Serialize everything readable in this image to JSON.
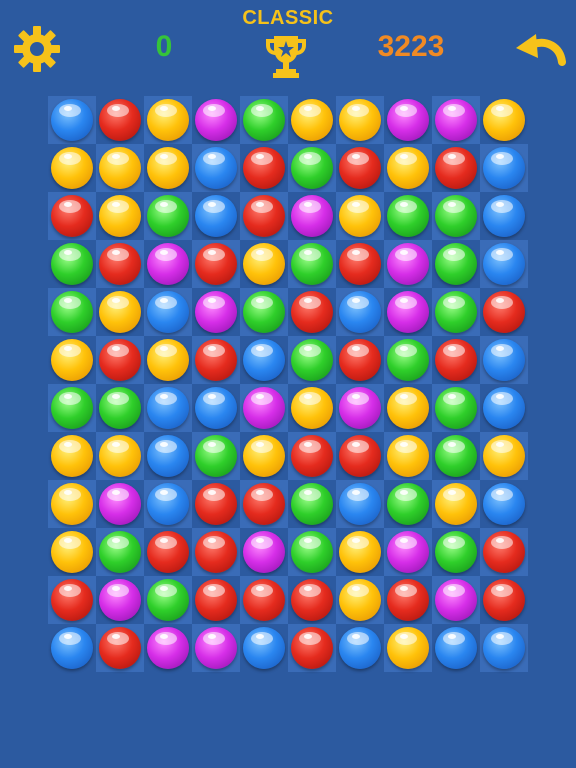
{
  "hud": {
    "mode_label": "CLASSIC",
    "score": "0",
    "best_score": "3223",
    "settings_icon": "gear-icon",
    "trophy_icon": "trophy-icon",
    "undo_icon": "undo-arrow-icon"
  },
  "colors": {
    "background": "#2c5aa0",
    "mode_label": "#f6c21a",
    "score": "#35c33a",
    "best_score": "#f08a24",
    "icons": "#f6c21a"
  },
  "board": {
    "columns": 10,
    "rows": 12,
    "grid": [
      [
        "blue",
        "red",
        "yellow",
        "magenta",
        "green",
        "yellow",
        "yellow",
        "magenta",
        "magenta",
        "yellow"
      ],
      [
        "yellow",
        "yellow",
        "yellow",
        "blue",
        "red",
        "green",
        "red",
        "yellow",
        "red",
        "blue"
      ],
      [
        "red",
        "yellow",
        "green",
        "blue",
        "red",
        "magenta",
        "yellow",
        "green",
        "green",
        "blue"
      ],
      [
        "green",
        "red",
        "magenta",
        "red",
        "yellow",
        "green",
        "red",
        "magenta",
        "green",
        "blue"
      ],
      [
        "green",
        "yellow",
        "blue",
        "magenta",
        "green",
        "red",
        "blue",
        "magenta",
        "green",
        "red"
      ],
      [
        "yellow",
        "red",
        "yellow",
        "red",
        "blue",
        "green",
        "red",
        "green",
        "red",
        "blue"
      ],
      [
        "green",
        "green",
        "blue",
        "blue",
        "magenta",
        "yellow",
        "magenta",
        "yellow",
        "green",
        "blue"
      ],
      [
        "yellow",
        "yellow",
        "blue",
        "green",
        "yellow",
        "red",
        "red",
        "yellow",
        "green",
        "yellow"
      ],
      [
        "yellow",
        "magenta",
        "blue",
        "red",
        "red",
        "green",
        "blue",
        "green",
        "yellow",
        "blue"
      ],
      [
        "yellow",
        "green",
        "red",
        "red",
        "magenta",
        "green",
        "yellow",
        "magenta",
        "green",
        "red"
      ],
      [
        "red",
        "magenta",
        "green",
        "red",
        "red",
        "red",
        "yellow",
        "red",
        "magenta",
        "red"
      ],
      [
        "blue",
        "red",
        "magenta",
        "magenta",
        "blue",
        "red",
        "blue",
        "yellow",
        "blue",
        "blue"
      ]
    ]
  }
}
